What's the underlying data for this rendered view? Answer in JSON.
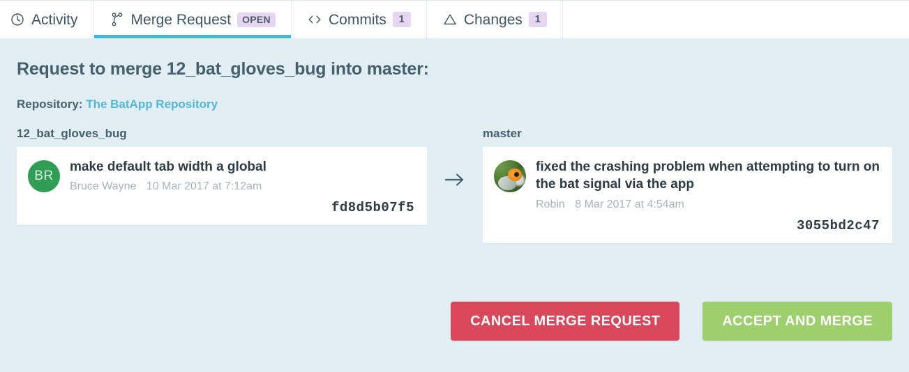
{
  "tabs": [
    {
      "id": "activity",
      "label": "Activity",
      "icon": "clock-icon",
      "badge": null,
      "active": false
    },
    {
      "id": "merge-request",
      "label": "Merge Request",
      "icon": "branch-icon",
      "badge": "OPEN",
      "active": true
    },
    {
      "id": "commits",
      "label": "Commits",
      "icon": "code-brackets-icon",
      "badge": "1",
      "active": false
    },
    {
      "id": "changes",
      "label": "Changes",
      "icon": "delta-triangle-icon",
      "badge": "1",
      "active": false
    }
  ],
  "header": {
    "title": "Request to merge 12_bat_gloves_bug into master:",
    "repository_label": "Repository:",
    "repository_name": "The BatApp Repository"
  },
  "compare": {
    "arrow_icon": "arrow-right-icon",
    "source": {
      "branch": "12_bat_gloves_bug",
      "avatar_type": "initials",
      "avatar_initials": "BR",
      "avatar_color": "#2f9e54",
      "commit_title": "make default tab width a global",
      "author": "Bruce Wayne",
      "date": "10 Mar 2017 at 7:12am",
      "hash": "fd8d5b07f5"
    },
    "target": {
      "branch": "master",
      "avatar_type": "photo",
      "avatar_alt": "robin-bird-avatar",
      "commit_title": "fixed the crashing problem when attempting to turn on the bat signal via the app",
      "author": "Robin",
      "date": "8 Mar 2017 at 4:54am",
      "hash": "3055bd2c47"
    }
  },
  "actions": {
    "cancel_label": "CANCEL MERGE REQUEST",
    "accept_label": "ACCEPT AND MERGE",
    "cancel_color": "#d9485a",
    "accept_color": "#9ecf6d"
  },
  "colors": {
    "panel_background": "#e1eef3",
    "accent_underline": "#3bbcdb",
    "link": "#4fb8d8",
    "badge_background": "#e6d6f1",
    "heading_text": "#46606e"
  }
}
